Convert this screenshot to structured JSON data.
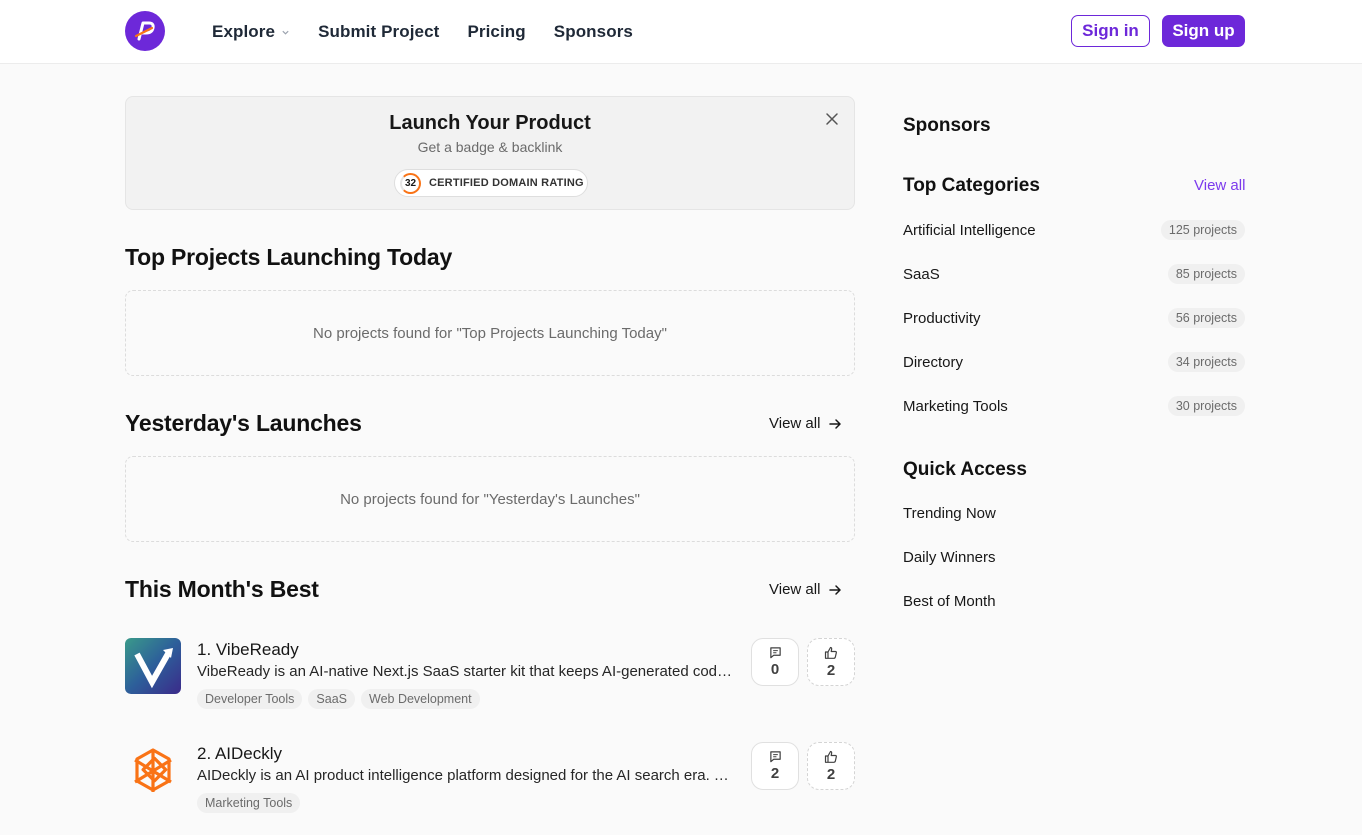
{
  "header": {
    "nav": [
      {
        "label": "Explore",
        "has_dropdown": true
      },
      {
        "label": "Submit Project"
      },
      {
        "label": "Pricing"
      },
      {
        "label": "Sponsors"
      }
    ],
    "sign_in": "Sign in",
    "sign_up": "Sign up"
  },
  "banner": {
    "title": "Launch Your Product",
    "subtitle": "Get a badge & backlink",
    "badge_score": "32",
    "badge_label": "CERTIFIED DOMAIN RATING"
  },
  "sections": {
    "today": {
      "title": "Top Projects Launching Today",
      "empty": "No projects found for \"Top Projects Launching Today\""
    },
    "yesterday": {
      "title": "Yesterday's Launches",
      "view_all": "View all",
      "empty": "No projects found for \"Yesterday's Launches\""
    },
    "month": {
      "title": "This Month's Best",
      "view_all": "View all",
      "projects": [
        {
          "name": "1. VibeReady",
          "description": "VibeReady is an AI-native Next.js SaaS starter kit that keeps AI-generated code consistent and maintainable.",
          "tags": [
            "Developer Tools",
            "SaaS",
            "Web Development"
          ],
          "comments": "0",
          "votes": "2",
          "icon": "vibeready-logo"
        },
        {
          "name": "2. AIDeckly",
          "description": "AIDeckly is an AI product intelligence platform designed for the AI search era. Track and optimize your visibility.",
          "tags": [
            "Marketing Tools"
          ],
          "comments": "2",
          "votes": "2",
          "icon": "aideckly-logo"
        }
      ]
    }
  },
  "sidebar": {
    "sponsors_title": "Sponsors",
    "categories_title": "Top Categories",
    "categories_view_all": "View all",
    "categories": [
      {
        "name": "Artificial Intelligence",
        "count": "125 projects"
      },
      {
        "name": "SaaS",
        "count": "85 projects"
      },
      {
        "name": "Productivity",
        "count": "56 projects"
      },
      {
        "name": "Directory",
        "count": "34 projects"
      },
      {
        "name": "Marketing Tools",
        "count": "30 projects"
      }
    ],
    "quick_title": "Quick Access",
    "quick_links": [
      "Trending Now",
      "Daily Winners",
      "Best of Month"
    ]
  },
  "colors": {
    "accent": "#6d28d9",
    "accent_link": "#7c3aed",
    "background": "#fafafa"
  }
}
